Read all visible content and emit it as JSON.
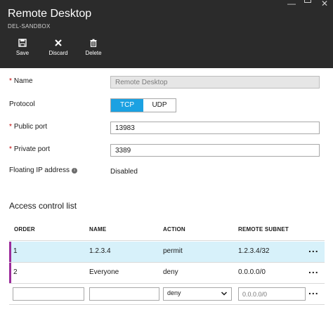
{
  "header": {
    "title": "Remote Desktop",
    "subtitle": "DEL-SANDBOX",
    "window_controls": {
      "minimize": "—",
      "close": "✕"
    },
    "toolbar": {
      "save_label": "Save",
      "discard_label": "Discard",
      "delete_label": "Delete"
    }
  },
  "form": {
    "name_label": "Name",
    "name_value": "Remote Desktop",
    "protocol_label": "Protocol",
    "protocol_options": [
      "TCP",
      "UDP"
    ],
    "protocol_selected": "TCP",
    "public_port_label": "Public port",
    "public_port_value": "13983",
    "private_port_label": "Private port",
    "private_port_value": "3389",
    "floating_ip_label": "Floating IP address",
    "floating_ip_value": "Disabled",
    "required_marker": "*",
    "info_icon": "i"
  },
  "acl": {
    "title": "Access control list",
    "columns": [
      "ORDER",
      "NAME",
      "ACTION",
      "REMOTE SUBNET"
    ],
    "rows": [
      {
        "order": "1",
        "name": "1.2.3.4",
        "action": "permit",
        "subnet": "1.2.3.4/32",
        "more": "..."
      },
      {
        "order": "2",
        "name": "Everyone",
        "action": "deny",
        "subnet": "0.0.0.0/0",
        "more": "..."
      }
    ],
    "new_row": {
      "order": "",
      "name": "",
      "action": "deny",
      "subnet_placeholder": "0.0.0.0/0",
      "more": "..."
    }
  },
  "colors": {
    "header_bg": "#2b2b2b",
    "accent": "#1ba1e2",
    "selected_row": "#d7f1fa",
    "row_marker": "#9c2c9c",
    "required": "#c00000"
  },
  "icons": [
    "save-icon",
    "discard-icon",
    "delete-icon",
    "info-icon",
    "chevron-down-icon"
  ]
}
